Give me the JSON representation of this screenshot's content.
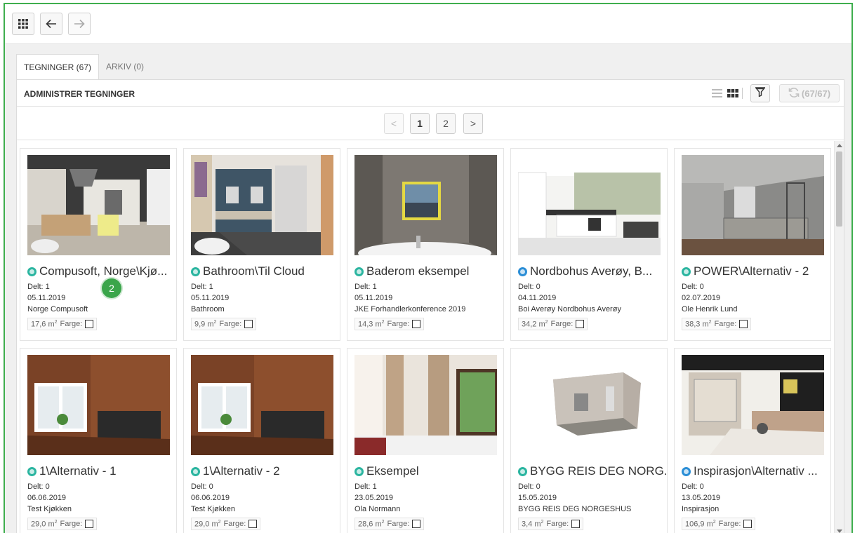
{
  "tabs": [
    {
      "label": "TEGNINGER (67)",
      "active": true
    },
    {
      "label": "ARKIV (0)",
      "active": false
    }
  ],
  "panel": {
    "title": "ADMINISTRER TEGNINGER",
    "sync_label": "(67/67)"
  },
  "pagination": {
    "prev": "<",
    "pages": [
      "1",
      "2"
    ],
    "current": "1",
    "next": ">"
  },
  "step_badge": "2",
  "cards": [
    {
      "title": "Compusoft, Norge\\Kjø...",
      "status": "green",
      "shared": "Delt: 1",
      "date": "05.11.2019",
      "owner": "Norge Compusoft",
      "area": "17,6 m",
      "color_label": "Farge:"
    },
    {
      "title": "Bathroom\\Til Cloud",
      "status": "green",
      "shared": "Delt: 1",
      "date": "05.11.2019",
      "owner": "Bathroom",
      "area": "9,9 m",
      "color_label": "Farge:"
    },
    {
      "title": "Baderom eksempel",
      "status": "green",
      "shared": "Delt: 1",
      "date": "05.11.2019",
      "owner": "JKE Forhandlerkonference 2019",
      "area": "14,3 m",
      "color_label": "Farge:"
    },
    {
      "title": "Nordbohus Averøy, B...",
      "status": "blue",
      "shared": "Delt: 0",
      "date": "04.11.2019",
      "owner": "Boi Averøy Nordbohus Averøy",
      "area": "34,2 m",
      "color_label": "Farge:"
    },
    {
      "title": "POWER\\Alternativ - 2",
      "status": "green",
      "shared": "Delt: 0",
      "date": "02.07.2019",
      "owner": "Ole Henrik Lund",
      "area": "38,3 m",
      "color_label": "Farge:"
    },
    {
      "title": "1\\Alternativ - 1",
      "status": "green",
      "shared": "Delt: 0",
      "date": "06.06.2019",
      "owner": "Test Kjøkken",
      "area": "29,0 m",
      "color_label": "Farge:"
    },
    {
      "title": "1\\Alternativ - 2",
      "status": "green",
      "shared": "Delt: 0",
      "date": "06.06.2019",
      "owner": "Test Kjøkken",
      "area": "29,0 m",
      "color_label": "Farge:"
    },
    {
      "title": "Eksempel",
      "status": "green",
      "shared": "Delt: 1",
      "date": "23.05.2019",
      "owner": "Ola Normann",
      "area": "28,6 m",
      "color_label": "Farge:"
    },
    {
      "title": "BYGG REIS DEG NORG...",
      "status": "green",
      "shared": "Delt: 0",
      "date": "15.05.2019",
      "owner": "BYGG REIS DEG NORGESHUS",
      "area": "3,4 m",
      "color_label": "Farge:"
    },
    {
      "title": "Inspirasjon\\Alternativ ...",
      "status": "blue",
      "shared": "Delt: 0",
      "date": "13.05.2019",
      "owner": "Inspirasjon",
      "area": "106,9 m",
      "color_label": "Farge:"
    }
  ],
  "area_unit_sup": "2",
  "icons": {
    "apps": "grid-icon",
    "back": "arrow-left-icon",
    "forward": "arrow-right-icon",
    "list_view": "list-view-icon",
    "grid_view": "grid-view-icon",
    "filter": "filter-icon",
    "sync": "sync-icon"
  },
  "colors": {
    "frame": "#3fae4e",
    "status_green": "#2bb5a0",
    "status_blue": "#2b8ed6",
    "step_badge": "#3aa54a"
  }
}
